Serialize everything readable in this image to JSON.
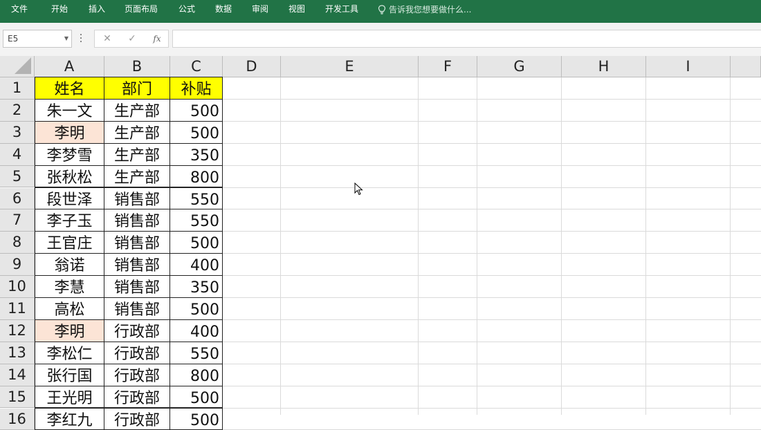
{
  "ribbon": {
    "tabs": [
      "文件",
      "开始",
      "插入",
      "页面布局",
      "公式",
      "数据",
      "审阅",
      "视图",
      "开发工具"
    ],
    "tell_me": "告诉我您想要做什么..."
  },
  "formula_bar": {
    "name_box": "E5",
    "formula": ""
  },
  "sheet": {
    "columns": [
      "A",
      "B",
      "C",
      "D",
      "E",
      "F",
      "G",
      "H",
      "I"
    ],
    "rows": [
      "1",
      "2",
      "3",
      "4",
      "5",
      "6",
      "7",
      "8",
      "9",
      "10",
      "11",
      "12",
      "13",
      "14",
      "15",
      "16"
    ],
    "header": {
      "name": "姓名",
      "dept": "部门",
      "bonus": "补贴"
    },
    "data": [
      {
        "name": "朱一文",
        "dept": "生产部",
        "bonus": "500",
        "dup": false
      },
      {
        "name": "李明",
        "dept": "生产部",
        "bonus": "500",
        "dup": true
      },
      {
        "name": "李梦雪",
        "dept": "生产部",
        "bonus": "350",
        "dup": false
      },
      {
        "name": "张秋松",
        "dept": "生产部",
        "bonus": "800",
        "dup": false
      },
      {
        "name": "段世泽",
        "dept": "销售部",
        "bonus": "550",
        "dup": false
      },
      {
        "name": "李子玉",
        "dept": "销售部",
        "bonus": "550",
        "dup": false
      },
      {
        "name": "王官庄",
        "dept": "销售部",
        "bonus": "500",
        "dup": false
      },
      {
        "name": "翁诺",
        "dept": "销售部",
        "bonus": "400",
        "dup": false
      },
      {
        "name": "李慧",
        "dept": "销售部",
        "bonus": "350",
        "dup": false
      },
      {
        "name": "高松",
        "dept": "销售部",
        "bonus": "500",
        "dup": false
      },
      {
        "name": "李明",
        "dept": "行政部",
        "bonus": "400",
        "dup": true
      },
      {
        "name": "李松仁",
        "dept": "行政部",
        "bonus": "550",
        "dup": false
      },
      {
        "name": "张行国",
        "dept": "行政部",
        "bonus": "800",
        "dup": false
      },
      {
        "name": "王光明",
        "dept": "行政部",
        "bonus": "500",
        "dup": false
      },
      {
        "name": "李红九",
        "dept": "行政部",
        "bonus": "500",
        "dup": false
      }
    ]
  },
  "colors": {
    "ribbon": "#217346",
    "header_fill": "#ffff00",
    "duplicate_fill": "#fce4d6"
  }
}
